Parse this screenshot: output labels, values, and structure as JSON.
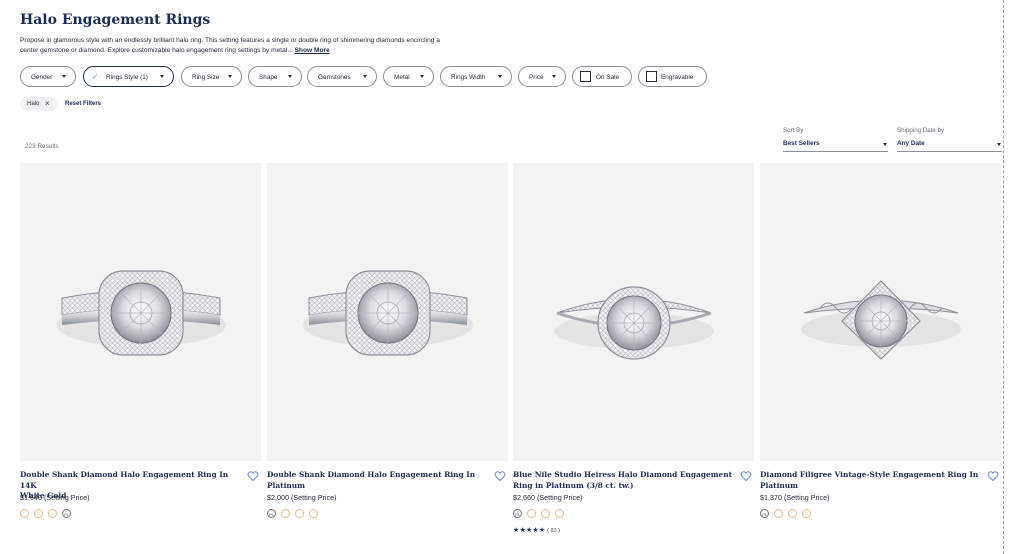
{
  "header": {
    "title": "Halo Engagement Rings",
    "description": "Propose in glamorous style with an endlessly brilliant halo ring. This setting features a single or double ring of shimmering diamonds encircling a center gemstone or diamond. Explore customizable halo engagement ring settings by metal... ",
    "show_more": "Show More"
  },
  "filters": [
    {
      "label": "Gender",
      "type": "dropdown"
    },
    {
      "label": "Rings Style (1)",
      "type": "dropdown",
      "active": true
    },
    {
      "label": "Ring Size",
      "type": "dropdown"
    },
    {
      "label": "Shape",
      "type": "dropdown"
    },
    {
      "label": "Gemstones",
      "type": "dropdown"
    },
    {
      "label": "Metal",
      "type": "dropdown"
    },
    {
      "label": "Rings Width",
      "type": "dropdown"
    },
    {
      "label": "Price",
      "type": "dropdown"
    },
    {
      "label": "On Sale",
      "type": "checkbox"
    },
    {
      "label": "Engravable",
      "type": "checkbox"
    }
  ],
  "applied_filters": {
    "tags": [
      "Halo"
    ],
    "reset_label": "Reset Filters"
  },
  "results": {
    "count_label": "223 Results"
  },
  "sort": {
    "sort_by": {
      "label": "Sort By",
      "value": "Best Sellers"
    },
    "shipping": {
      "label": "Shipping Date by",
      "value": "Any Date"
    }
  },
  "products": [
    {
      "title_line1": "Double Shank Diamond Halo Engagement Ring In 14K",
      "title_line2": "White Gold",
      "price": "$1,640 (Setting Price)",
      "metal_swatches": [
        "gold",
        "gold",
        "gold",
        "platinum"
      ],
      "ring_style": "cushion-halo-double-shank"
    },
    {
      "title_line1": "Double Shank Diamond Halo Engagement Ring In",
      "title_line2": "Platinum",
      "price": "$2,000 (Setting Price)",
      "metal_swatches": [
        "platinum",
        "gold",
        "gold",
        "gold"
      ],
      "ring_style": "cushion-halo-double-shank"
    },
    {
      "title_line1": "Blue Nile Studio Heiress Halo Diamond Engagement",
      "title_line2": "Ring in Platinum (3/8 ct. tw.)",
      "price": "$2,660 (Setting Price)",
      "metal_swatches": [
        "platinum",
        "gold",
        "gold",
        "gold"
      ],
      "rating": {
        "stars": "★★★★★",
        "count": "( 82 )"
      },
      "ring_style": "round-halo-pave"
    },
    {
      "title_line1": "Diamond Filigree Vintage-Style Engagement Ring In",
      "title_line2": "Platinum",
      "price": "$1,370 (Setting Price)",
      "metal_swatches": [
        "platinum",
        "gold",
        "gold",
        "gold"
      ],
      "ring_style": "vintage-filigree"
    }
  ],
  "icons": {
    "favorite": "heart-icon",
    "dropdown": "chevron-down-icon",
    "remove": "close-icon",
    "checked": "check-icon"
  },
  "colors": {
    "brand_navy": "#1d2b55",
    "gold_swatch": "#e7b98c",
    "heart": "#6d8bd4"
  }
}
